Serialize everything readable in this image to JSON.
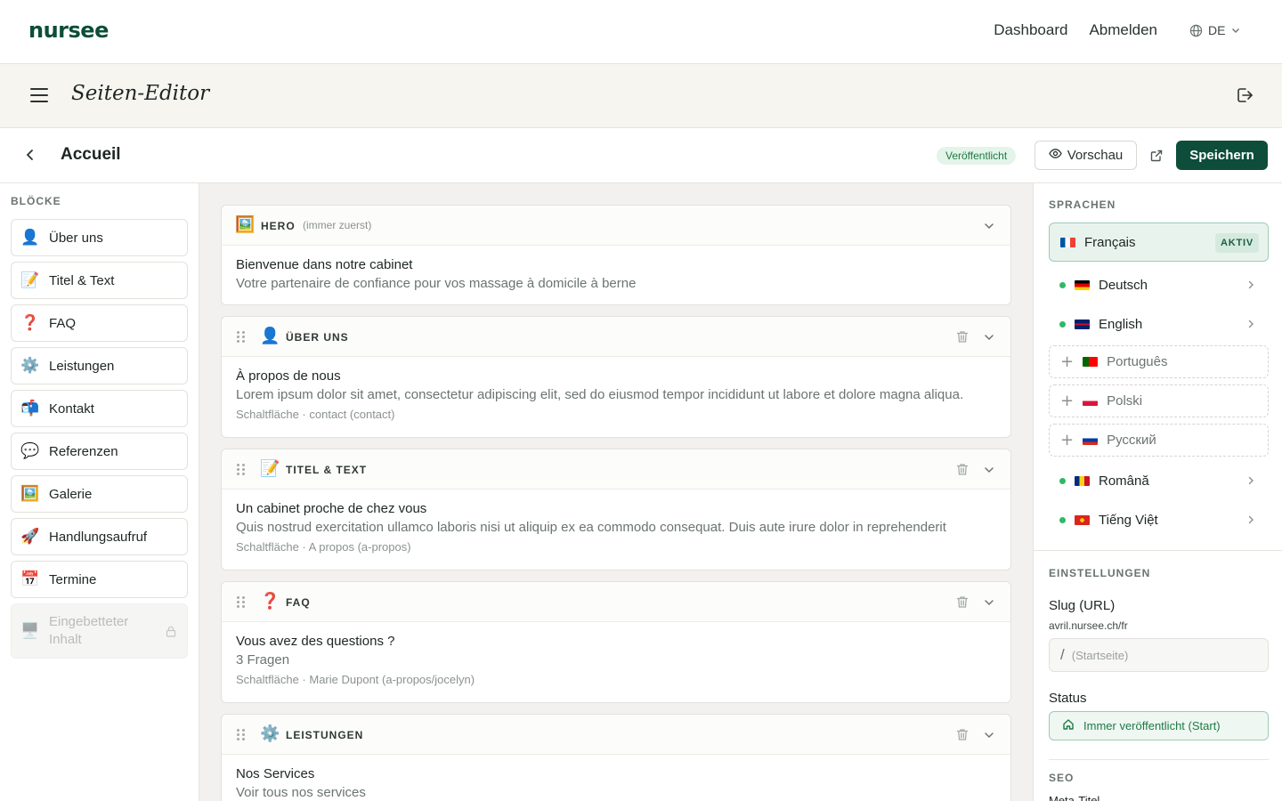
{
  "topbar": {
    "brand": "nursee",
    "nav": [
      "Dashboard",
      "Abmelden"
    ],
    "language": "DE"
  },
  "editor": {
    "title": "Seiten-Editor"
  },
  "page": {
    "name": "Accueil",
    "status": "Veröffentlicht",
    "preview_label": "Vorschau",
    "save_label": "Speichern"
  },
  "blocks": {
    "label": "BLÖCKE",
    "items": [
      {
        "icon": "👤",
        "label": "Über uns"
      },
      {
        "icon": "📝",
        "label": "Titel & Text"
      },
      {
        "icon": "❓",
        "label": "FAQ"
      },
      {
        "icon": "⚙️",
        "label": "Leistungen"
      },
      {
        "icon": "📬",
        "label": "Kontakt"
      },
      {
        "icon": "💬",
        "label": "Referenzen"
      },
      {
        "icon": "🖼️",
        "label": "Galerie"
      },
      {
        "icon": "🚀",
        "label": "Handlungsaufruf"
      },
      {
        "icon": "📅",
        "label": "Termine"
      }
    ],
    "disabled": {
      "icon": "🖥️",
      "label_line1": "Eingebetteter",
      "label_line2": "Inhalt"
    }
  },
  "cards": [
    {
      "icon": "🖼️",
      "type": "HERO",
      "hint": "(immer zuerst)",
      "title": "Bienvenue dans notre cabinet",
      "sub": "Votre partenaire de confiance pour vos massage à domicile à berne",
      "meta": ""
    },
    {
      "icon": "👤",
      "type": "ÜBER UNS",
      "hint": "",
      "title": "À propos de nous",
      "sub": "Lorem ipsum dolor sit amet, consectetur adipiscing elit, sed do eiusmod tempor incididunt ut labore et dolore magna aliqua.",
      "meta": "Schaltfläche · contact (contact)"
    },
    {
      "icon": "📝",
      "type": "TITEL & TEXT",
      "hint": "",
      "title": "Un cabinet proche de chez vous",
      "sub": "Quis nostrud exercitation ullamco laboris nisi ut aliquip ex ea commodo consequat. Duis aute irure dolor in reprehenderit",
      "meta": "Schaltfläche · A propos (a-propos)"
    },
    {
      "icon": "❓",
      "type": "FAQ",
      "hint": "",
      "title": "Vous avez des questions ?",
      "sub": "3 Fragen",
      "meta": "Schaltfläche · Marie Dupont (a-propos/jocelyn)"
    },
    {
      "icon": "⚙️",
      "type": "LEISTUNGEN",
      "hint": "",
      "title": "Nos Services",
      "sub": "Voir tous nos services",
      "meta": ""
    }
  ],
  "languages": {
    "label": "SPRACHEN",
    "active": {
      "name": "Français",
      "badge": "AKTIV",
      "flag": "fr"
    },
    "items": [
      {
        "name": "Deutsch",
        "flag": "de",
        "state": "exists"
      },
      {
        "name": "English",
        "flag": "gb",
        "state": "exists"
      },
      {
        "name": "Português",
        "flag": "pt",
        "state": "add"
      },
      {
        "name": "Polski",
        "flag": "pl",
        "state": "add"
      },
      {
        "name": "Русский",
        "flag": "ru",
        "state": "add"
      },
      {
        "name": "Română",
        "flag": "ro",
        "state": "exists"
      },
      {
        "name": "Tiếng Việt",
        "flag": "vn",
        "state": "exists"
      }
    ]
  },
  "settings": {
    "label": "EINSTELLUNGEN",
    "slug_label": "Slug (URL)",
    "slug_base": "avril.nursee.ch/fr",
    "slug_slash": "/",
    "slug_placeholder": "(Startseite)",
    "status_label": "Status",
    "status_value": "Immer veröffentlicht (Start)",
    "seo_label": "SEO",
    "meta_title_label": "Meta-Titel"
  },
  "colors": {
    "brand": "#0d4d3a",
    "published": "#1f7a45",
    "dot": "#2fb866"
  }
}
